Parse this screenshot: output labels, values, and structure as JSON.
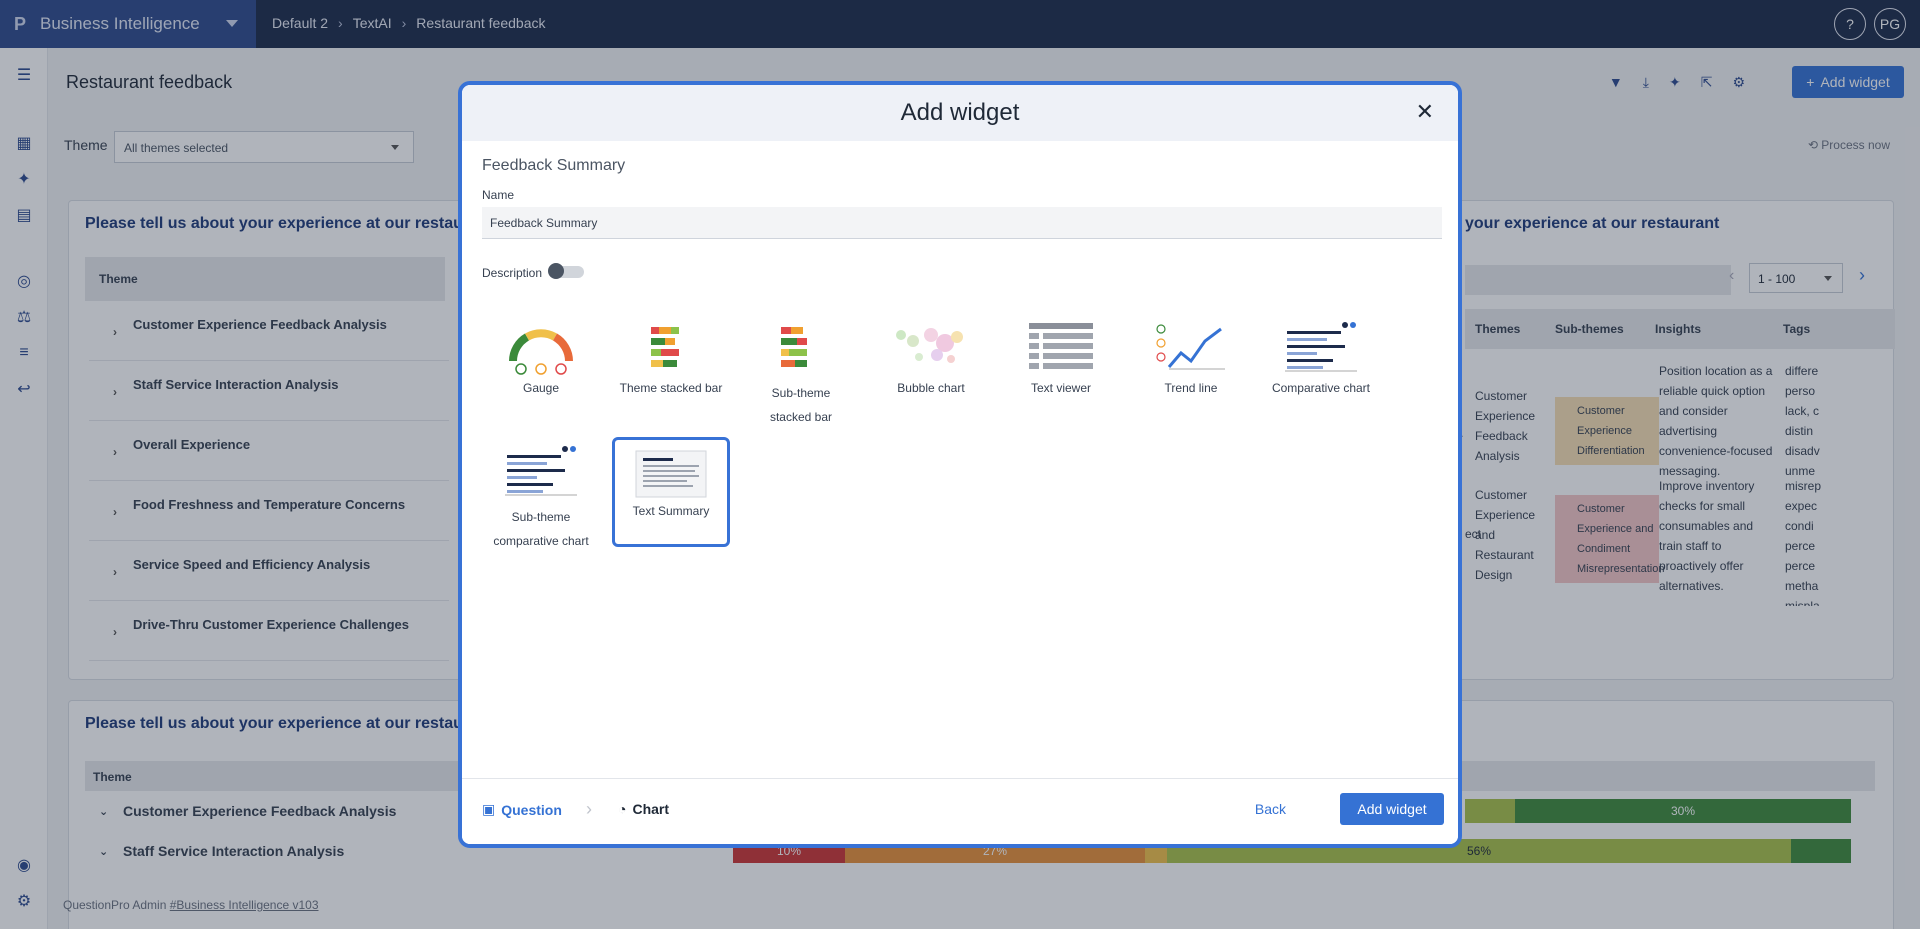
{
  "topbar": {
    "logo": "P",
    "app_name": "Business Intelligence",
    "breadcrumbs": [
      "Default 2",
      "TextAI",
      "Restaurant feedback"
    ],
    "help": "?",
    "user_initials": "PG"
  },
  "page": {
    "title": "Restaurant feedback",
    "add_widget_label": "Add widget",
    "theme_label": "Theme",
    "theme_value": "All themes selected",
    "process_now": "Process now"
  },
  "card1": {
    "title_left": "Please tell us about your experience at our restaura",
    "title_right": "your experience at our restaurant",
    "theme_header": "Theme",
    "rows": [
      "Customer Experience Feedback Analysis",
      "Staff Service Interaction Analysis",
      "Overall Experience",
      "Food Freshness and Temperature Concerns",
      "Service Speed and Efficiency Analysis",
      "Drive-Thru Customer Experience Challenges"
    ],
    "pager": "1 - 100",
    "right_headers": [
      "Themes",
      "Sub-themes",
      "Insights",
      "Tags"
    ],
    "right_rows": [
      {
        "snippet": "y.",
        "theme": "Customer Experience Feedback Analysis",
        "subtheme": "Customer Experience Differentiation",
        "insight": "Position location as a reliable quick option and consider advertising convenience-focused messaging.",
        "tags": "differe perso lack, c distin disadv unme"
      },
      {
        "snippet": "ect",
        "theme": "Customer Experience and Restaurant Design",
        "subtheme": "Customer Experience and Condiment Misrepresentation",
        "insight": "Improve inventory checks for small consumables and train staff to proactively offer alternatives.",
        "tags": "misrep expec condi perce perce metha mispla"
      }
    ]
  },
  "card2": {
    "title": "Please tell us about your experience at our restaura",
    "theme_header": "Theme",
    "rows": [
      "Customer Experience Feedback Analysis",
      "Staff Service Interaction Analysis"
    ],
    "bars_row1": [
      "30%"
    ],
    "bars_row2": [
      "10%",
      "27%",
      "56%"
    ]
  },
  "modal": {
    "title": "Add widget",
    "section": "Feedback Summary",
    "name_label": "Name",
    "name_value": "Feedback Summary",
    "description_label": "Description",
    "widgets": [
      "Gauge",
      "Theme stacked bar",
      "Sub-theme stacked bar",
      "Bubble chart",
      "Text viewer",
      "Trend line",
      "Comparative chart",
      "Sub-theme comparative chart",
      "Text Summary"
    ],
    "selected_widget": "Text Summary",
    "steps": [
      "Question",
      "Chart"
    ],
    "back": "Back",
    "add": "Add widget"
  },
  "footer": {
    "prefix": "QuestionPro Admin ",
    "link": "#Business Intelligence v103"
  },
  "colors": {
    "topbar": "#1d2b4b",
    "accent": "#3572d4",
    "selected_border": "#3872d6"
  }
}
